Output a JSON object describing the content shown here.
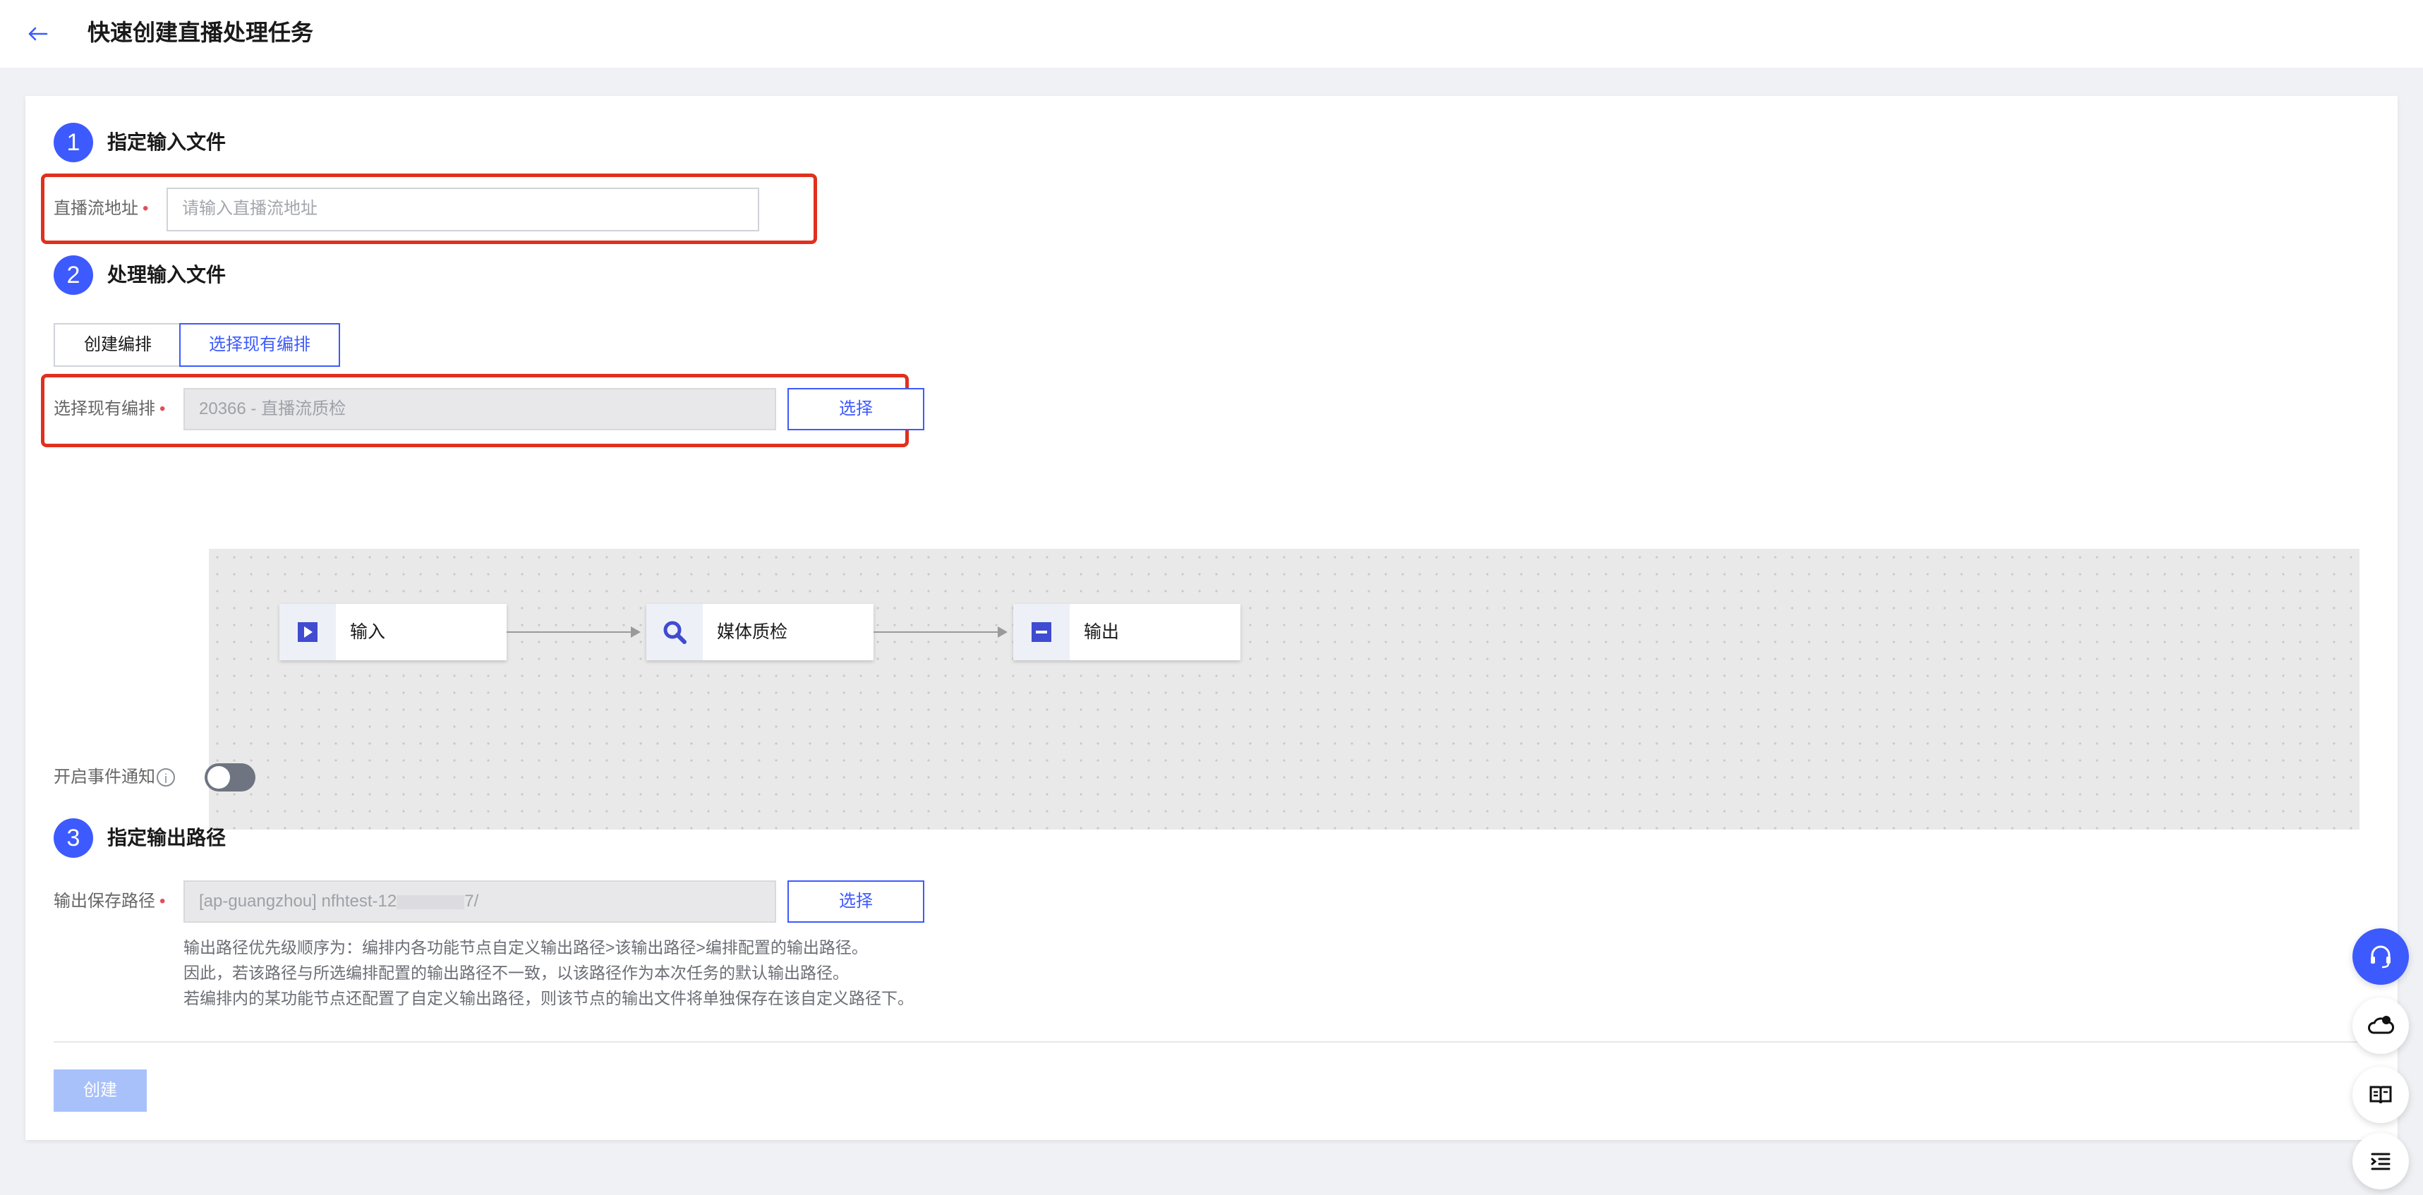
{
  "header": {
    "title": "快速创建直播处理任务",
    "back_icon": "arrow-left-icon"
  },
  "step1": {
    "number": "1",
    "title": "指定输入文件",
    "stream_label": "直播流地址",
    "stream_placeholder": "请输入直播流地址"
  },
  "step2": {
    "number": "2",
    "title": "处理输入文件",
    "tabs": [
      {
        "label": "创建编排",
        "active": false
      },
      {
        "label": "选择现有编排",
        "active": true
      }
    ],
    "select_label": "选择现有编排",
    "select_value": "20366 - 直播流质检",
    "select_button": "选择",
    "flow": {
      "nodes": [
        {
          "label": "输入",
          "icon": "play-icon"
        },
        {
          "label": "媒体质检",
          "icon": "search-icon"
        },
        {
          "label": "输出",
          "icon": "output-icon"
        }
      ]
    },
    "event_label": "开启事件通知",
    "event_info_icon": "i",
    "event_enabled": false
  },
  "step3": {
    "number": "3",
    "title": "指定输出路径",
    "output_label": "输出保存路径",
    "output_prefix": "[ap-guangzhou] nfhtest-12",
    "output_suffix": "7/",
    "output_button": "选择",
    "notes": [
      "输出路径优先级顺序为：编排内各功能节点自定义输出路径>该输出路径>编排配置的输出路径。",
      "因此，若该路径与所选编排配置的输出路径不一致，以该路径作为本次任务的默认输出路径。",
      "若编排内的某功能节点还配置了自定义输出路径，则该节点的输出文件将单独保存在该自定义路径下。"
    ]
  },
  "footer": {
    "create_button": "创建"
  },
  "float_buttons": [
    "headset-icon",
    "cloud-bell-icon",
    "book-icon",
    "list-icon"
  ],
  "colors": {
    "accent": "#3d5afe",
    "highlight": "#e0301e",
    "required": "#e34d59",
    "disabled_button": "#a8c1fb"
  }
}
